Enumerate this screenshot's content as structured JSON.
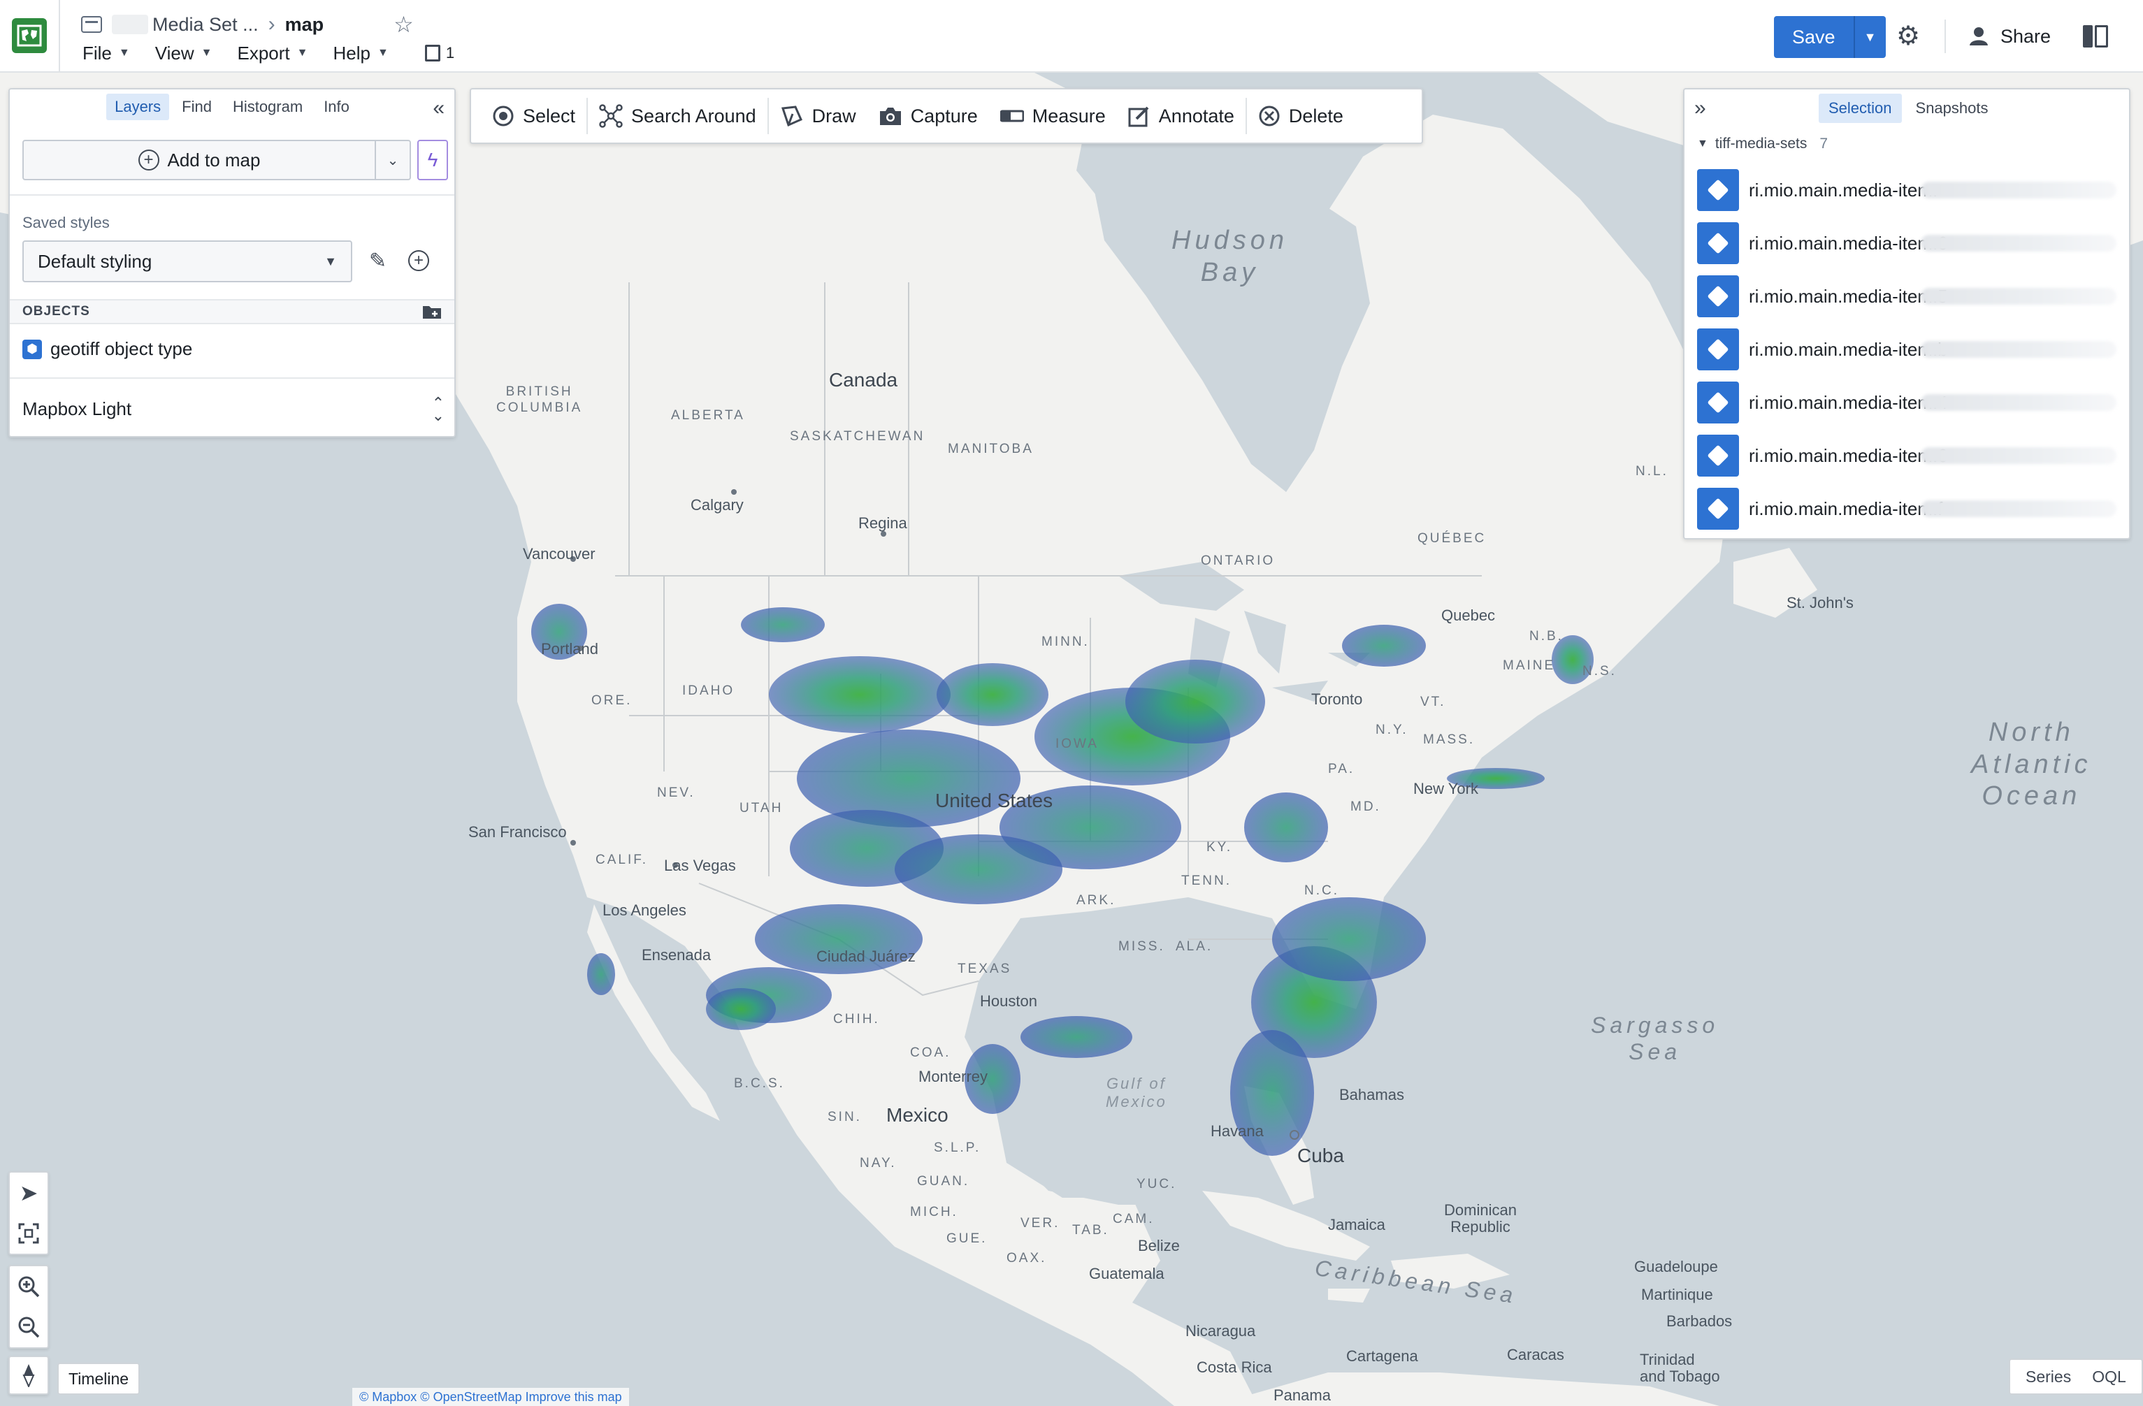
{
  "header": {
    "folder": "Media Set ...",
    "title": "map",
    "menus": [
      "File",
      "View",
      "Export",
      "Help"
    ],
    "dataset_count": "1",
    "save_label": "Save",
    "share_label": "Share"
  },
  "left_panel": {
    "tabs": [
      "Layers",
      "Find",
      "Histogram",
      "Info"
    ],
    "active_tab": "Layers",
    "add_to_map": "Add to map",
    "saved_styles_label": "Saved styles",
    "saved_style_value": "Default styling",
    "objects_header": "OBJECTS",
    "object_layer": "geotiff object type",
    "basemap": "Mapbox Light"
  },
  "toolbar": {
    "tools": [
      {
        "label": "Select",
        "icon": "select-icon"
      },
      {
        "label": "Search Around",
        "icon": "search-around-icon"
      },
      {
        "label": "Draw",
        "icon": "draw-icon"
      },
      {
        "label": "Capture",
        "icon": "camera-icon"
      },
      {
        "label": "Measure",
        "icon": "ruler-icon"
      },
      {
        "label": "Annotate",
        "icon": "annotate-icon"
      },
      {
        "label": "Delete",
        "icon": "delete-icon"
      }
    ]
  },
  "right_panel": {
    "tabs": [
      "Selection",
      "Snapshots"
    ],
    "active_tab": "Selection",
    "group_name": "tiff-media-sets",
    "group_count": "7",
    "items": [
      "ri.mio.main.media-item.",
      "ri.mio.main.media-item.6",
      "ri.mio.main.media-item.5",
      "ri.mio.main.media-item.b",
      "ri.mio.main.media-item.4",
      "ri.mio.main.media-item.6",
      "ri.mio.main.media-item.f"
    ]
  },
  "map": {
    "labels": {
      "hudson_bay": "Hudson\nBay",
      "canada": "Canada",
      "british_columbia": "BRITISH\nCOLUMBIA",
      "alberta": "ALBERTA",
      "saskatchewan": "SASKATCHEWAN",
      "manitoba": "MANITOBA",
      "ontario": "ONTARIO",
      "quebec_prov": "QUÉBEC",
      "nl": "N.L.",
      "calgary": "Calgary",
      "regina": "Regina",
      "vancouver": "Vancouver",
      "portland": "Portland",
      "quebec": "Quebec",
      "st_johns": "St. John's",
      "maine": "MAINE",
      "nb": "N.B.",
      "ns": "N.S.",
      "toronto": "Toronto",
      "united_states": "United States",
      "idaho": "IDAHO",
      "ore": "ORE.",
      "nev": "NEV.",
      "utah": "UTAH",
      "calif": "CALIF.",
      "san_francisco": "San Francisco",
      "las_vegas": "Las Vegas",
      "los_angeles": "Los Angeles",
      "ensenada": "Ensenada",
      "juarez": "Ciudad Juárez",
      "texas": "TEXAS",
      "houston": "Houston",
      "iowa": "IOWA",
      "minn": "MINN.",
      "ark": "ARK.",
      "tenn": "TENN.",
      "nc": "N.C.",
      "pa": "PA.",
      "md": "MD.",
      "ky": "KY.",
      "miss": "MISS.",
      "ala": "ALA.",
      "ny": "N.Y.",
      "vt": "VT.",
      "mass": "MASS.",
      "new_york": "New York",
      "north_atlantic": "North\nAtlantic\nOcean",
      "sargasso": "Sargasso\nSea",
      "gulf": "Gulf of\nMexico",
      "mexico": "Mexico",
      "chih": "CHIH.",
      "coa": "COA.",
      "bcs": "B.C.S.",
      "sin": "SIN.",
      "nay": "NAY.",
      "slp": "S.L.P.",
      "guan": "GUAN.",
      "mich": "MICH.",
      "gue": "GUE.",
      "oax": "OAX.",
      "ver": "VER.",
      "tab": "TAB.",
      "cam": "CAM.",
      "yuc": "YUC.",
      "monterrey": "Monterrey",
      "havana": "Havana",
      "bahamas": "Bahamas",
      "cuba": "Cuba",
      "jamaica": "Jamaica",
      "dominican": "Dominican\nRepublic",
      "belize": "Belize",
      "guatemala": "Guatemala",
      "caribbean": "Caribbean Sea",
      "nicaragua": "Nicaragua",
      "costa_rica": "Costa Rica",
      "panama": "Panama",
      "cartagena": "Cartagena",
      "caracas": "Caracas",
      "guadeloupe": "Guadeloupe",
      "martinique": "Martinique",
      "barbados": "Barbados",
      "trinidad": "Trinidad\nand Tobago"
    },
    "timeline_label": "Timeline",
    "attribution": "© Mapbox © OpenStreetMap Improve this map",
    "bottom_right": [
      "Series",
      "OQL"
    ]
  },
  "colors": {
    "accent": "#2d72d2",
    "land": "#f2f2f0",
    "water": "#cdd6dc",
    "raster_low": "#3d5fb0",
    "raster_mid": "#2f9e7a",
    "raster_high": "#3cb043"
  }
}
